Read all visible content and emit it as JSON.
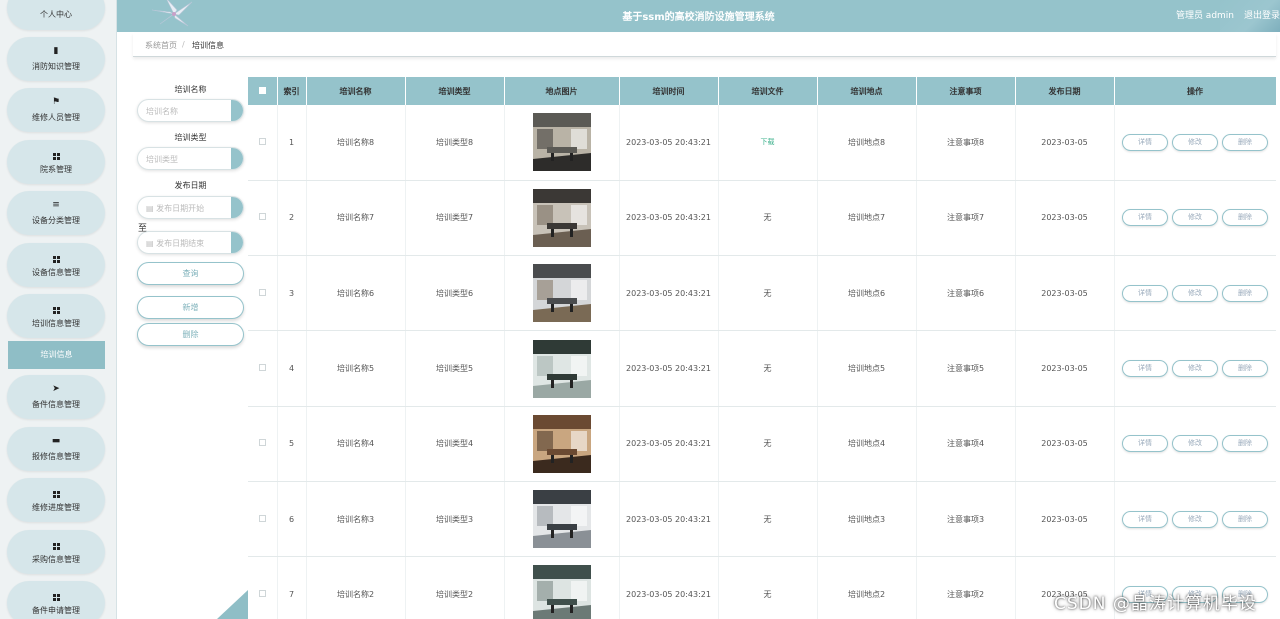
{
  "header": {
    "title": "基于ssm的高校消防设施管理系统",
    "user": "管理员 admin",
    "logout": "退出登录"
  },
  "sidebar": {
    "items": [
      {
        "label": "个人中心",
        "icon": "user-icon"
      },
      {
        "label": "消防知识管理",
        "icon": "book-icon"
      },
      {
        "label": "维修人员管理",
        "icon": "flag-icon"
      },
      {
        "label": "院系管理",
        "icon": "grid-icon"
      },
      {
        "label": "设备分类管理",
        "icon": "list-icon"
      },
      {
        "label": "设备信息管理",
        "icon": "grid-icon"
      },
      {
        "label": "培训信息管理",
        "icon": "grid-icon"
      },
      {
        "label": "备件信息管理",
        "icon": "send-icon"
      },
      {
        "label": "报修信息管理",
        "icon": "monitor-icon"
      },
      {
        "label": "维修进度管理",
        "icon": "grid-icon"
      },
      {
        "label": "采购信息管理",
        "icon": "grid-icon"
      },
      {
        "label": "备件申请管理",
        "icon": "grid-icon"
      }
    ],
    "active_sub": "培训信息"
  },
  "breadcrumb": {
    "home": "系统首页",
    "sep": "/",
    "current": "培训信息"
  },
  "filter": {
    "name_label": "培训名称",
    "name_placeholder": "培训名称",
    "type_label": "培训类型",
    "type_placeholder": "培训类型",
    "date_label": "发布日期",
    "date_start_placeholder": "发布日期开始",
    "to": "至",
    "date_end_placeholder": "发布日期结束",
    "query": "查询",
    "add": "新增",
    "delete": "删除"
  },
  "table": {
    "headers": [
      "索引",
      "培训名称",
      "培训类型",
      "地点图片",
      "培训时间",
      "培训文件",
      "培训地点",
      "注意事项",
      "发布日期",
      "操作"
    ],
    "actions": {
      "detail": "详情",
      "edit": "修改",
      "delete": "删除"
    },
    "rows": [
      {
        "index": "1",
        "name": "培训名称8",
        "type": "培训类型8",
        "time": "2023-03-05 20:43:21",
        "file": "下载",
        "place": "培训地点8",
        "note": "注意事项8",
        "date": "2023-03-05"
      },
      {
        "index": "2",
        "name": "培训名称7",
        "type": "培训类型7",
        "time": "2023-03-05 20:43:21",
        "file": "无",
        "place": "培训地点7",
        "note": "注意事项7",
        "date": "2023-03-05"
      },
      {
        "index": "3",
        "name": "培训名称6",
        "type": "培训类型6",
        "time": "2023-03-05 20:43:21",
        "file": "无",
        "place": "培训地点6",
        "note": "注意事项6",
        "date": "2023-03-05"
      },
      {
        "index": "4",
        "name": "培训名称5",
        "type": "培训类型5",
        "time": "2023-03-05 20:43:21",
        "file": "无",
        "place": "培训地点5",
        "note": "注意事项5",
        "date": "2023-03-05"
      },
      {
        "index": "5",
        "name": "培训名称4",
        "type": "培训类型4",
        "time": "2023-03-05 20:43:21",
        "file": "无",
        "place": "培训地点4",
        "note": "注意事项4",
        "date": "2023-03-05"
      },
      {
        "index": "6",
        "name": "培训名称3",
        "type": "培训类型3",
        "time": "2023-03-05 20:43:21",
        "file": "无",
        "place": "培训地点3",
        "note": "注意事项3",
        "date": "2023-03-05"
      },
      {
        "index": "7",
        "name": "培训名称2",
        "type": "培训类型2",
        "time": "2023-03-05 20:43:21",
        "file": "无",
        "place": "培训地点2",
        "note": "注意事项2",
        "date": "2023-03-05"
      }
    ]
  },
  "watermark": "CSDN @晶涛计算机毕设"
}
